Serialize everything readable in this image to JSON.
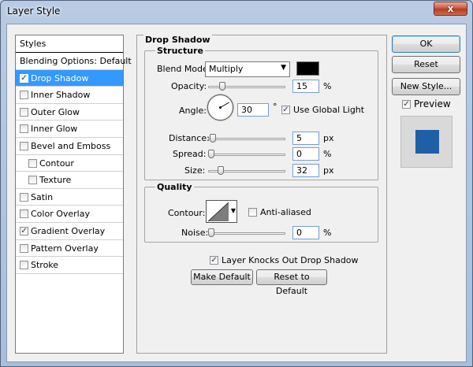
{
  "window": {
    "title": "Layer Style",
    "close_glyph": "x"
  },
  "styles_list": {
    "header": "Styles",
    "items": [
      {
        "label": "Blending Options: Default",
        "checkbox": false,
        "checked": false,
        "selected": false,
        "indent": false
      },
      {
        "label": "Drop Shadow",
        "checkbox": true,
        "checked": true,
        "selected": true,
        "indent": false
      },
      {
        "label": "Inner Shadow",
        "checkbox": true,
        "checked": false,
        "selected": false,
        "indent": false
      },
      {
        "label": "Outer Glow",
        "checkbox": true,
        "checked": false,
        "selected": false,
        "indent": false
      },
      {
        "label": "Inner Glow",
        "checkbox": true,
        "checked": false,
        "selected": false,
        "indent": false
      },
      {
        "label": "Bevel and Emboss",
        "checkbox": true,
        "checked": false,
        "selected": false,
        "indent": false
      },
      {
        "label": "Contour",
        "checkbox": true,
        "checked": false,
        "selected": false,
        "indent": true
      },
      {
        "label": "Texture",
        "checkbox": true,
        "checked": false,
        "selected": false,
        "indent": true
      },
      {
        "label": "Satin",
        "checkbox": true,
        "checked": false,
        "selected": false,
        "indent": false
      },
      {
        "label": "Color Overlay",
        "checkbox": true,
        "checked": false,
        "selected": false,
        "indent": false
      },
      {
        "label": "Gradient Overlay",
        "checkbox": true,
        "checked": true,
        "selected": false,
        "indent": false
      },
      {
        "label": "Pattern Overlay",
        "checkbox": true,
        "checked": false,
        "selected": false,
        "indent": false
      },
      {
        "label": "Stroke",
        "checkbox": true,
        "checked": false,
        "selected": false,
        "indent": false
      }
    ]
  },
  "drop_shadow": {
    "title": "Drop Shadow",
    "structure": {
      "title": "Structure",
      "blend_mode_label": "Blend Mode:",
      "blend_mode_value": "Multiply",
      "color": "#000000",
      "opacity_label": "Opacity:",
      "opacity_value": "15",
      "opacity_level": 0.15,
      "percent_unit": "%",
      "angle_label": "Angle:",
      "angle_value": "30",
      "angle_unit": "°",
      "use_global_light_label": "Use Global Light",
      "use_global_light_checked": true,
      "distance_label": "Distance:",
      "distance_value": "5",
      "distance_level": 0.02,
      "spread_label": "Spread:",
      "spread_value": "0",
      "spread_level": 0.0,
      "size_label": "Size:",
      "size_value": "32",
      "size_level": 0.13,
      "px_unit": "px"
    },
    "quality": {
      "title": "Quality",
      "contour_label": "Contour:",
      "anti_aliased_label": "Anti-aliased",
      "anti_aliased_checked": false,
      "noise_label": "Noise:",
      "noise_value": "0",
      "noise_level": 0.0
    },
    "knocks_out_label": "Layer Knocks Out Drop Shadow",
    "knocks_out_checked": true,
    "make_default_label": "Make Default",
    "reset_default_label": "Reset to Default"
  },
  "buttons": {
    "ok": "OK",
    "reset": "Reset",
    "new_style": "New Style...",
    "preview_label": "Preview",
    "preview_checked": true,
    "preview_color": "#1f5fa6"
  }
}
